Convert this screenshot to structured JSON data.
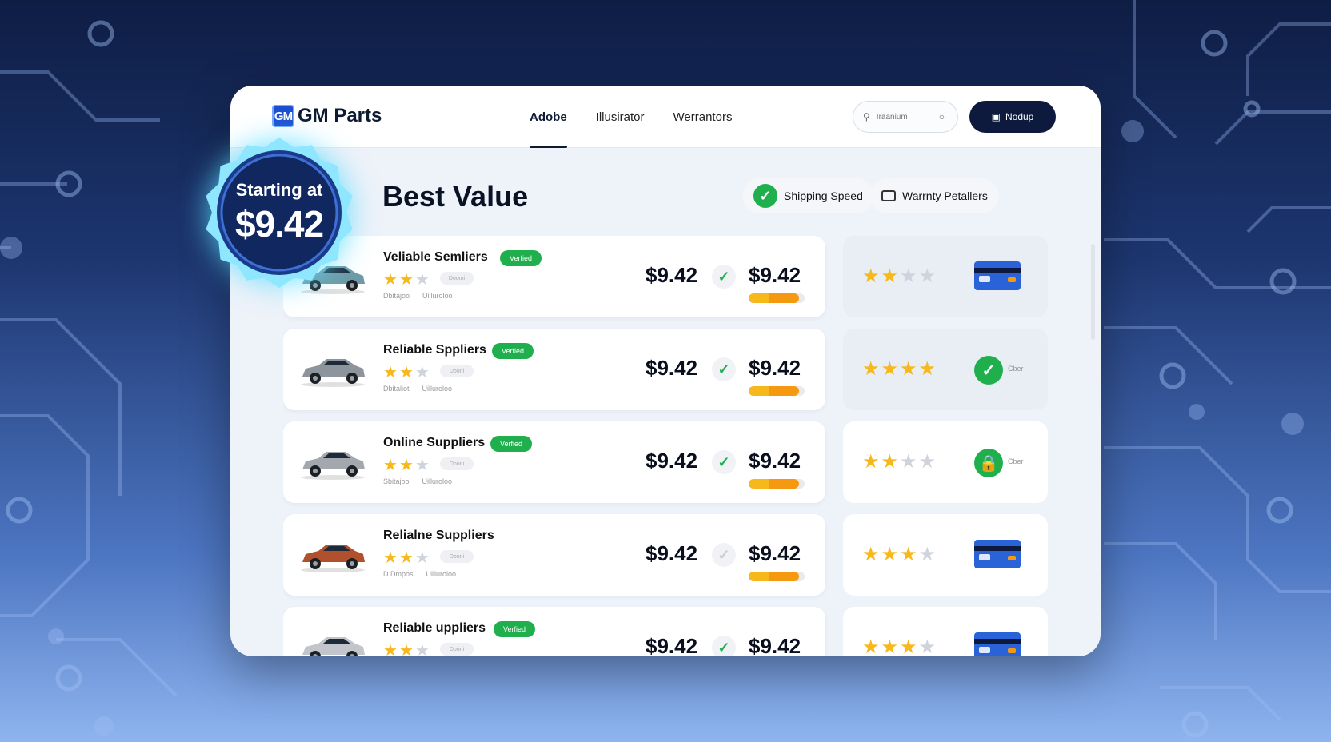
{
  "app": {
    "logo_mark": "GM",
    "title": "GM Parts"
  },
  "nav": {
    "items": [
      {
        "label": "Adobe",
        "active": true
      },
      {
        "label": "Illusirator",
        "active": false
      },
      {
        "label": "Werrantors",
        "active": false
      }
    ]
  },
  "search": {
    "placeholder": "Iraanium"
  },
  "header_button": {
    "label": "Nodup"
  },
  "badge": {
    "line1": "Starting at",
    "price": "$9.42"
  },
  "page": {
    "heading": "Best Value"
  },
  "filters": {
    "shipping_label": "Shipping Speed",
    "warranty_label": "Warrnty Petallers"
  },
  "suppliers": [
    {
      "name": "Veliable Semliers",
      "verified": "Verfied",
      "rating": 2,
      "pill": "Doomi",
      "meta1": "Dbitajoo",
      "meta2": "Uilluroloo",
      "price_a": "$9.42",
      "check": true,
      "price_b": "$9.42",
      "bar_level": 0.9,
      "side_rating": 2,
      "side_icon": "credit-card",
      "side_label": "",
      "car_color": "#6e9aa6"
    },
    {
      "name": "Reliable Sppliers",
      "verified": "Verfied",
      "rating": 2,
      "pill": "Dooni",
      "meta1": "Dbitaliot",
      "meta2": "Uilluroloo",
      "price_a": "$9.42",
      "check": true,
      "price_b": "$9.42",
      "bar_level": 0.9,
      "side_rating": 4,
      "side_icon": "check-circle",
      "side_label": "Cber",
      "car_color": "#8d949c"
    },
    {
      "name": "Online Suppliers",
      "verified": "Verfied",
      "rating": 2,
      "pill": "Dooni",
      "meta1": "Sbitajoo",
      "meta2": "Uilluroloo",
      "price_a": "$9.42",
      "check": true,
      "price_b": "$9.42",
      "bar_level": 0.9,
      "side_rating": 2,
      "side_icon": "lock",
      "side_label": "Cber",
      "car_color": "#a2a8ae"
    },
    {
      "name": "Relialne Suppliers",
      "verified": "",
      "rating": 2,
      "pill": "Dooni",
      "meta1": "D Dmpos",
      "meta2": "Uilluroloo",
      "price_a": "$9.42",
      "check": false,
      "price_b": "$9.42",
      "bar_level": 0.9,
      "side_rating": 3,
      "side_icon": "credit-card",
      "side_label": "",
      "car_color": "#b0502c"
    },
    {
      "name": "Reliable uppliers",
      "verified": "Verfied",
      "rating": 2,
      "pill": "Dooni",
      "meta1": "",
      "meta2": "",
      "price_a": "$9.42",
      "check": true,
      "price_b": "$9.42",
      "bar_level": 0.9,
      "side_rating": 3,
      "side_icon": "credit-card",
      "side_label": "",
      "car_color": "#c2c6cc"
    }
  ]
}
